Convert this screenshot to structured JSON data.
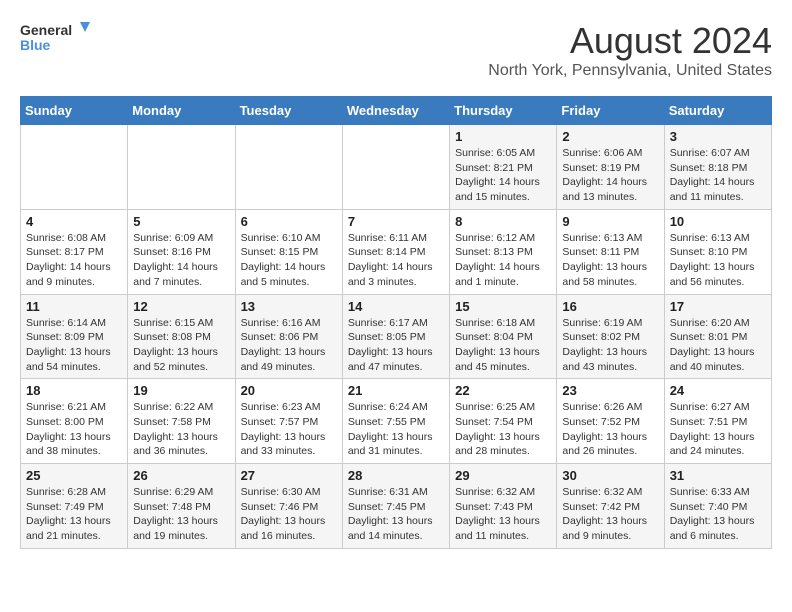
{
  "logo": {
    "line1": "General",
    "line2": "Blue"
  },
  "title": "August 2024",
  "subtitle": "North York, Pennsylvania, United States",
  "headers": [
    "Sunday",
    "Monday",
    "Tuesday",
    "Wednesday",
    "Thursday",
    "Friday",
    "Saturday"
  ],
  "weeks": [
    [
      {
        "day": "",
        "info": ""
      },
      {
        "day": "",
        "info": ""
      },
      {
        "day": "",
        "info": ""
      },
      {
        "day": "",
        "info": ""
      },
      {
        "day": "1",
        "info": "Sunrise: 6:05 AM\nSunset: 8:21 PM\nDaylight: 14 hours\nand 15 minutes."
      },
      {
        "day": "2",
        "info": "Sunrise: 6:06 AM\nSunset: 8:19 PM\nDaylight: 14 hours\nand 13 minutes."
      },
      {
        "day": "3",
        "info": "Sunrise: 6:07 AM\nSunset: 8:18 PM\nDaylight: 14 hours\nand 11 minutes."
      }
    ],
    [
      {
        "day": "4",
        "info": "Sunrise: 6:08 AM\nSunset: 8:17 PM\nDaylight: 14 hours\nand 9 minutes."
      },
      {
        "day": "5",
        "info": "Sunrise: 6:09 AM\nSunset: 8:16 PM\nDaylight: 14 hours\nand 7 minutes."
      },
      {
        "day": "6",
        "info": "Sunrise: 6:10 AM\nSunset: 8:15 PM\nDaylight: 14 hours\nand 5 minutes."
      },
      {
        "day": "7",
        "info": "Sunrise: 6:11 AM\nSunset: 8:14 PM\nDaylight: 14 hours\nand 3 minutes."
      },
      {
        "day": "8",
        "info": "Sunrise: 6:12 AM\nSunset: 8:13 PM\nDaylight: 14 hours\nand 1 minute."
      },
      {
        "day": "9",
        "info": "Sunrise: 6:13 AM\nSunset: 8:11 PM\nDaylight: 13 hours\nand 58 minutes."
      },
      {
        "day": "10",
        "info": "Sunrise: 6:13 AM\nSunset: 8:10 PM\nDaylight: 13 hours\nand 56 minutes."
      }
    ],
    [
      {
        "day": "11",
        "info": "Sunrise: 6:14 AM\nSunset: 8:09 PM\nDaylight: 13 hours\nand 54 minutes."
      },
      {
        "day": "12",
        "info": "Sunrise: 6:15 AM\nSunset: 8:08 PM\nDaylight: 13 hours\nand 52 minutes."
      },
      {
        "day": "13",
        "info": "Sunrise: 6:16 AM\nSunset: 8:06 PM\nDaylight: 13 hours\nand 49 minutes."
      },
      {
        "day": "14",
        "info": "Sunrise: 6:17 AM\nSunset: 8:05 PM\nDaylight: 13 hours\nand 47 minutes."
      },
      {
        "day": "15",
        "info": "Sunrise: 6:18 AM\nSunset: 8:04 PM\nDaylight: 13 hours\nand 45 minutes."
      },
      {
        "day": "16",
        "info": "Sunrise: 6:19 AM\nSunset: 8:02 PM\nDaylight: 13 hours\nand 43 minutes."
      },
      {
        "day": "17",
        "info": "Sunrise: 6:20 AM\nSunset: 8:01 PM\nDaylight: 13 hours\nand 40 minutes."
      }
    ],
    [
      {
        "day": "18",
        "info": "Sunrise: 6:21 AM\nSunset: 8:00 PM\nDaylight: 13 hours\nand 38 minutes."
      },
      {
        "day": "19",
        "info": "Sunrise: 6:22 AM\nSunset: 7:58 PM\nDaylight: 13 hours\nand 36 minutes."
      },
      {
        "day": "20",
        "info": "Sunrise: 6:23 AM\nSunset: 7:57 PM\nDaylight: 13 hours\nand 33 minutes."
      },
      {
        "day": "21",
        "info": "Sunrise: 6:24 AM\nSunset: 7:55 PM\nDaylight: 13 hours\nand 31 minutes."
      },
      {
        "day": "22",
        "info": "Sunrise: 6:25 AM\nSunset: 7:54 PM\nDaylight: 13 hours\nand 28 minutes."
      },
      {
        "day": "23",
        "info": "Sunrise: 6:26 AM\nSunset: 7:52 PM\nDaylight: 13 hours\nand 26 minutes."
      },
      {
        "day": "24",
        "info": "Sunrise: 6:27 AM\nSunset: 7:51 PM\nDaylight: 13 hours\nand 24 minutes."
      }
    ],
    [
      {
        "day": "25",
        "info": "Sunrise: 6:28 AM\nSunset: 7:49 PM\nDaylight: 13 hours\nand 21 minutes."
      },
      {
        "day": "26",
        "info": "Sunrise: 6:29 AM\nSunset: 7:48 PM\nDaylight: 13 hours\nand 19 minutes."
      },
      {
        "day": "27",
        "info": "Sunrise: 6:30 AM\nSunset: 7:46 PM\nDaylight: 13 hours\nand 16 minutes."
      },
      {
        "day": "28",
        "info": "Sunrise: 6:31 AM\nSunset: 7:45 PM\nDaylight: 13 hours\nand 14 minutes."
      },
      {
        "day": "29",
        "info": "Sunrise: 6:32 AM\nSunset: 7:43 PM\nDaylight: 13 hours\nand 11 minutes."
      },
      {
        "day": "30",
        "info": "Sunrise: 6:32 AM\nSunset: 7:42 PM\nDaylight: 13 hours\nand 9 minutes."
      },
      {
        "day": "31",
        "info": "Sunrise: 6:33 AM\nSunset: 7:40 PM\nDaylight: 13 hours\nand 6 minutes."
      }
    ]
  ]
}
